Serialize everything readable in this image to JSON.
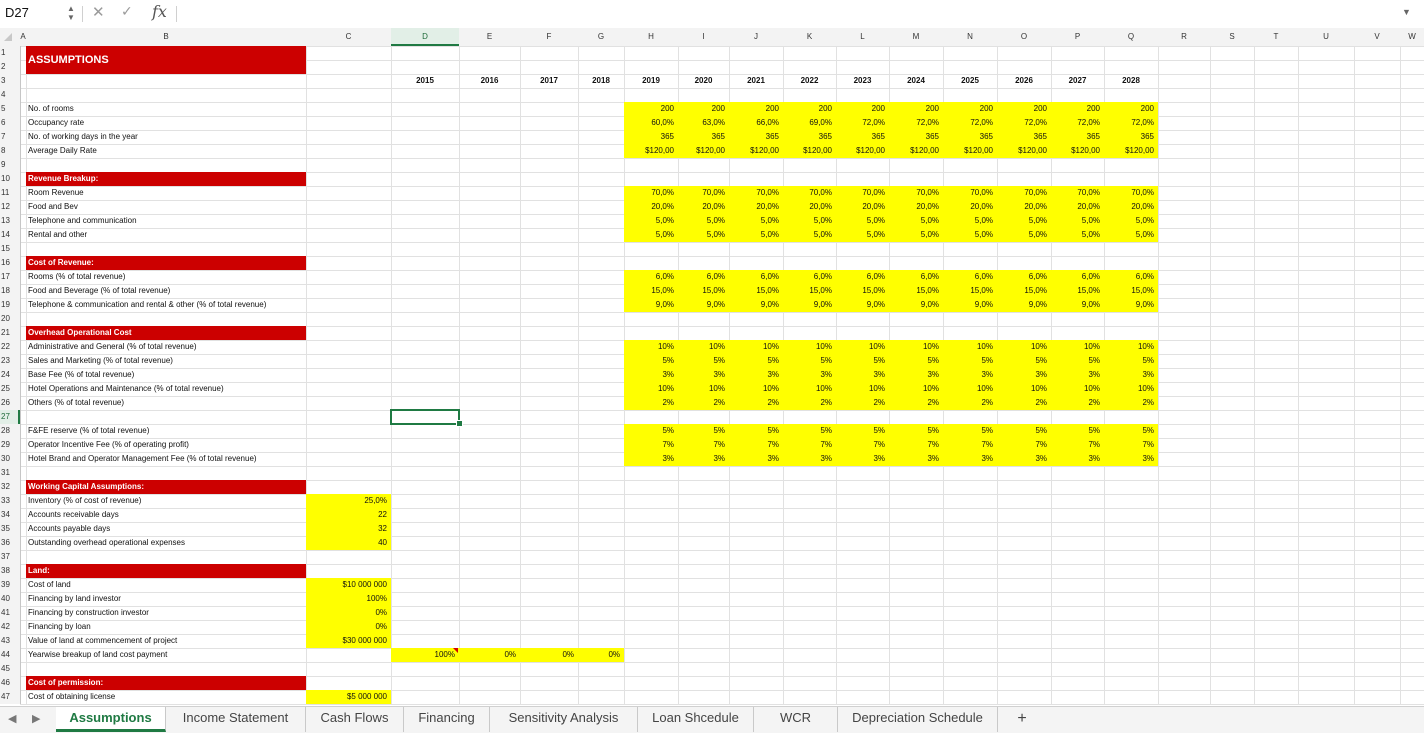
{
  "formula_bar": {
    "name_box": "D27",
    "cancel_icon": "✕",
    "confirm_icon": "✓",
    "fx_label": "fx",
    "formula": ""
  },
  "colors": {
    "section_band": "#cc0000",
    "input_highlight": "#ffff00",
    "selection": "#1f7a43"
  },
  "sheet": {
    "columns": [
      "A",
      "B",
      "C",
      "D",
      "E",
      "F",
      "G",
      "H",
      "I",
      "J",
      "K",
      "L",
      "M",
      "N",
      "O",
      "P",
      "Q",
      "R",
      "S",
      "T",
      "U",
      "V",
      "W"
    ],
    "rows": [
      "1",
      "2",
      "3",
      "4",
      "5",
      "6",
      "7",
      "8",
      "9",
      "10",
      "11",
      "12",
      "13",
      "14",
      "15",
      "16",
      "17",
      "18",
      "19",
      "20",
      "21",
      "22",
      "23",
      "24",
      "25",
      "26",
      "27",
      "28",
      "29",
      "30",
      "31",
      "32",
      "33",
      "34",
      "35",
      "36",
      "37",
      "38",
      "39",
      "40",
      "41",
      "42",
      "43",
      "44",
      "45",
      "46",
      "47"
    ],
    "active_cell": "D27",
    "title": "ASSUMPTIONS",
    "years": [
      "2015",
      "2016",
      "2017",
      "2018",
      "2019",
      "2020",
      "2021",
      "2022",
      "2023",
      "2024",
      "2025",
      "2026",
      "2027",
      "2028"
    ],
    "rooms_block": {
      "labels": [
        "No. of rooms",
        "Occupancy rate",
        "No. of working days in the year",
        "Average Daily Rate"
      ],
      "values": [
        [
          "200",
          "200",
          "200",
          "200",
          "200",
          "200",
          "200",
          "200",
          "200",
          "200"
        ],
        [
          "60,0%",
          "63,0%",
          "66,0%",
          "69,0%",
          "72,0%",
          "72,0%",
          "72,0%",
          "72,0%",
          "72,0%",
          "72,0%"
        ],
        [
          "365",
          "365",
          "365",
          "365",
          "365",
          "365",
          "365",
          "365",
          "365",
          "365"
        ],
        [
          "$120,00",
          "$120,00",
          "$120,00",
          "$120,00",
          "$120,00",
          "$120,00",
          "$120,00",
          "$120,00",
          "$120,00",
          "$120,00"
        ]
      ]
    },
    "revenue_breakup": {
      "header": "Revenue Breakup:",
      "labels": [
        "Room Revenue",
        "Food and Bev",
        "Telephone and communication",
        "Rental and other"
      ],
      "values": [
        [
          "70,0%",
          "70,0%",
          "70,0%",
          "70,0%",
          "70,0%",
          "70,0%",
          "70,0%",
          "70,0%",
          "70,0%",
          "70,0%"
        ],
        [
          "20,0%",
          "20,0%",
          "20,0%",
          "20,0%",
          "20,0%",
          "20,0%",
          "20,0%",
          "20,0%",
          "20,0%",
          "20,0%"
        ],
        [
          "5,0%",
          "5,0%",
          "5,0%",
          "5,0%",
          "5,0%",
          "5,0%",
          "5,0%",
          "5,0%",
          "5,0%",
          "5,0%"
        ],
        [
          "5,0%",
          "5,0%",
          "5,0%",
          "5,0%",
          "5,0%",
          "5,0%",
          "5,0%",
          "5,0%",
          "5,0%",
          "5,0%"
        ]
      ]
    },
    "cost_of_revenue": {
      "header": "Cost of Revenue:",
      "labels": [
        "Rooms (% of total revenue)",
        "Food and Beverage (% of total revenue)",
        "Telephone & communication and rental & other (% of total revenue)"
      ],
      "values": [
        [
          "6,0%",
          "6,0%",
          "6,0%",
          "6,0%",
          "6,0%",
          "6,0%",
          "6,0%",
          "6,0%",
          "6,0%",
          "6,0%"
        ],
        [
          "15,0%",
          "15,0%",
          "15,0%",
          "15,0%",
          "15,0%",
          "15,0%",
          "15,0%",
          "15,0%",
          "15,0%",
          "15,0%"
        ],
        [
          "9,0%",
          "9,0%",
          "9,0%",
          "9,0%",
          "9,0%",
          "9,0%",
          "9,0%",
          "9,0%",
          "9,0%",
          "9,0%"
        ]
      ]
    },
    "overhead": {
      "header": "Overhead Operational Cost",
      "labels": [
        "Administrative and General (% of total revenue)",
        "Sales and Marketing (% of total revenue)",
        "Base Fee (% of total revenue)",
        "Hotel Operations and Maintenance (% of total revenue)",
        "Others (% of total revenue)"
      ],
      "values": [
        [
          "10%",
          "10%",
          "10%",
          "10%",
          "10%",
          "10%",
          "10%",
          "10%",
          "10%",
          "10%"
        ],
        [
          "5%",
          "5%",
          "5%",
          "5%",
          "5%",
          "5%",
          "5%",
          "5%",
          "5%",
          "5%"
        ],
        [
          "3%",
          "3%",
          "3%",
          "3%",
          "3%",
          "3%",
          "3%",
          "3%",
          "3%",
          "3%"
        ],
        [
          "10%",
          "10%",
          "10%",
          "10%",
          "10%",
          "10%",
          "10%",
          "10%",
          "10%",
          "10%"
        ],
        [
          "2%",
          "2%",
          "2%",
          "2%",
          "2%",
          "2%",
          "2%",
          "2%",
          "2%",
          "2%"
        ]
      ]
    },
    "reserves": {
      "labels": [
        "F&FE reserve (% of total revenue)",
        "Operator Incentive Fee (% of operating profit)",
        "Hotel Brand and Operator Management Fee (% of total revenue)"
      ],
      "values": [
        [
          "5%",
          "5%",
          "5%",
          "5%",
          "5%",
          "5%",
          "5%",
          "5%",
          "5%",
          "5%"
        ],
        [
          "7%",
          "7%",
          "7%",
          "7%",
          "7%",
          "7%",
          "7%",
          "7%",
          "7%",
          "7%"
        ],
        [
          "3%",
          "3%",
          "3%",
          "3%",
          "3%",
          "3%",
          "3%",
          "3%",
          "3%",
          "3%"
        ]
      ]
    },
    "working_capital": {
      "header": "Working Capital Assumptions:",
      "labels": [
        "Inventory (% of cost of revenue)",
        "Accounts receivable days",
        "Accounts payable days",
        "Outstanding overhead operational expenses"
      ],
      "values": [
        "25,0%",
        "22",
        "32",
        "40"
      ]
    },
    "land": {
      "header": "Land:",
      "labels": [
        "Cost of land",
        "Financing by land investor",
        "Financing by construction investor",
        "Financing by loan",
        "Value of land at commencement of project",
        "Yearwise breakup of land cost payment"
      ],
      "values": [
        "$10 000 000",
        "100%",
        "0%",
        "0%",
        "$30 000 000"
      ],
      "breakup": [
        "100%",
        "0%",
        "0%",
        "0%"
      ]
    },
    "permission": {
      "header": "Cost of permission:",
      "labels": [
        "Cost of obtaining license"
      ],
      "values": [
        "$5 000 000"
      ]
    }
  },
  "tabs": [
    {
      "label": "Assumptions",
      "active": true
    },
    {
      "label": "Income Statement",
      "active": false
    },
    {
      "label": "Cash Flows",
      "active": false
    },
    {
      "label": "Financing",
      "active": false
    },
    {
      "label": "Sensitivity Analysis",
      "active": false
    },
    {
      "label": "Loan Shcedule",
      "active": false
    },
    {
      "label": "WCR",
      "active": false
    },
    {
      "label": "Depreciation Schedule",
      "active": false
    }
  ],
  "tab_nav": {
    "prev": "◀",
    "next": "▶",
    "add": "+"
  }
}
